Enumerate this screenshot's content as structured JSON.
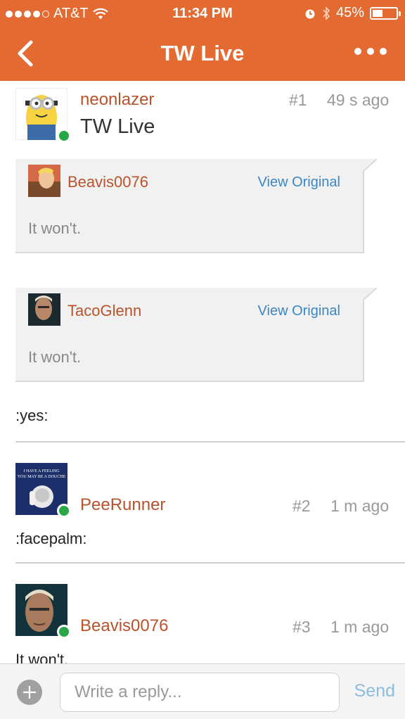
{
  "status_bar": {
    "carrier": "AT&T",
    "time": "11:34 PM",
    "battery": "45%",
    "battery_level": 0.45
  },
  "nav": {
    "title": "TW Live",
    "back_icon": "chevron-left-icon",
    "more_icon": "more-dots-icon"
  },
  "posts": [
    {
      "username": "neonlazer",
      "number": "#1",
      "time": "49 s ago",
      "thread_title": "TW Live",
      "quotes": [
        {
          "username": "Beavis0076",
          "view_label": "View Original",
          "text": "It won't."
        },
        {
          "username": "TacoGlenn",
          "view_label": "View Original",
          "text": "It won't."
        }
      ],
      "text": ":yes:"
    },
    {
      "username": "PeeRunner",
      "number": "#2",
      "time": "1 m ago",
      "avatar_text": "I HAVE A FEELING YOU MAY BE A DOUCHE",
      "text": ":facepalm:"
    },
    {
      "username": "Beavis0076",
      "number": "#3",
      "time": "1 m ago",
      "text": "It won't."
    }
  ],
  "reply": {
    "placeholder": "Write a reply...",
    "send_label": "Send"
  },
  "colors": {
    "header": "#e36a30",
    "username": "#b9532b",
    "link": "#3b87c4",
    "online": "#27a845"
  }
}
